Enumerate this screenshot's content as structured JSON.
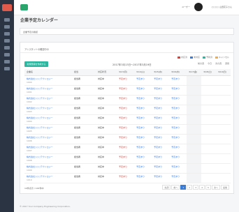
{
  "topbar": {
    "user_label": "ユーザー",
    "user_name": "○○○○ 山田花子さん"
  },
  "page_title": "企業予定カレンダー",
  "breadcrumb": "企業予定の確認",
  "panel": {
    "heading": "アシスタントの確認中の",
    "create_button": "新規登録を作成する",
    "week_label": "2017年3月13日～2017年3月19日",
    "nav": [
      "前の週",
      "今日",
      "次の週",
      "週間"
    ],
    "legend": [
      {
        "label": "対応済",
        "color": "#d9433b"
      },
      {
        "label": "未対応",
        "color": "#3b7cd6"
      },
      {
        "label": "予約済",
        "color": "#2bb7a0"
      },
      {
        "label": "キャンセル",
        "color": "#f0ad4e"
      }
    ]
  },
  "table": {
    "headers": [
      "企業名",
      "担当",
      "対応状況",
      "3/13(月)",
      "3/14(火)",
      "3/15(水)",
      "3/16(木)",
      "3/17(金)",
      "3/18(土)",
      "3/19(日)"
    ],
    "rows": [
      {
        "name": "株式会社○○○テクノロジー",
        "id": "1000",
        "staff": "担当者",
        "status": "対応中"
      },
      {
        "name": "株式会社○○○テクノロジー",
        "id": "1001",
        "staff": "担当者",
        "status": "対応中"
      },
      {
        "name": "株式会社○○○テクノロジー",
        "id": "1002",
        "staff": "担当者",
        "status": "対応中"
      },
      {
        "name": "株式会社○○○テクノロジー",
        "id": "1003",
        "staff": "担当者",
        "status": "対応中"
      },
      {
        "name": "株式会社○○○テクノロジー",
        "id": "1004",
        "staff": "担当者",
        "status": "対応中"
      },
      {
        "name": "株式会社○○○テクノロジー",
        "id": "1005",
        "staff": "担当者",
        "status": "対応中"
      },
      {
        "name": "株式会社○○○テクノロジー",
        "id": "1006",
        "staff": "担当者",
        "status": "対応中"
      },
      {
        "name": "株式会社○○○テクノロジー",
        "id": "1007",
        "staff": "担当者",
        "status": "対応中"
      },
      {
        "name": "株式会社○○○テクノロジー",
        "id": "1008",
        "staff": "担当者",
        "status": "対応中"
      },
      {
        "name": "株式会社○○○テクノロジー",
        "id": "1009",
        "staff": "担当者",
        "status": "対応中"
      },
      {
        "name": "株式会社○○○テクノロジー",
        "id": "1010",
        "staff": "担当者",
        "status": "対応中"
      }
    ],
    "slot_text": "予定あり"
  },
  "footer": {
    "count": "10件表示 / 100件中",
    "pager": [
      "先頭",
      "前へ",
      "1",
      "2",
      "3",
      "4",
      "5",
      "次へ",
      "最後"
    ],
    "active_page": "1"
  },
  "copyright": "© 2017 Your Company Engineering Corporation."
}
